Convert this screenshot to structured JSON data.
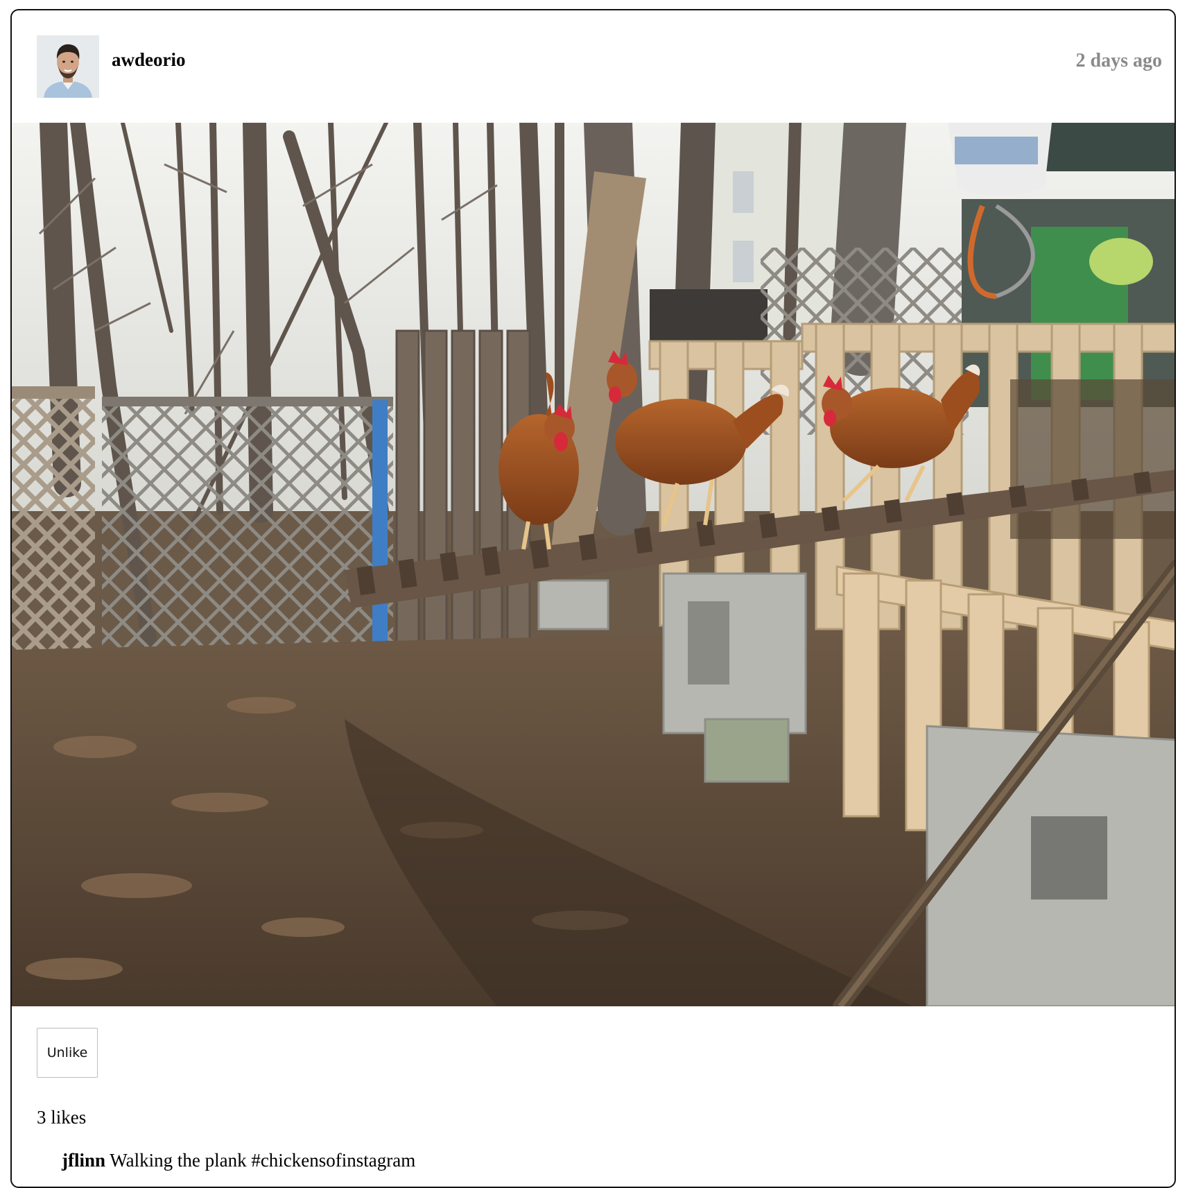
{
  "post": {
    "owner": "awdeorio",
    "timestamp": "2 days ago",
    "avatar_icon": "profile-photo",
    "like_button_label": "Unlike",
    "likes_text": "3 likes",
    "comments": [
      {
        "owner": "jflinn",
        "text": "Walking the plank #chickensofinstagram"
      }
    ]
  },
  "colors": {
    "border": "#111111",
    "timestamp": "#8a8a8a",
    "button_border": "#bdbdbd"
  }
}
